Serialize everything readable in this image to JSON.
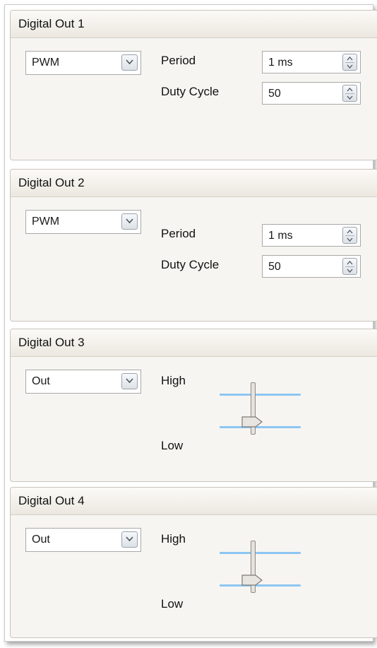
{
  "panels": [
    {
      "title": "Digital Out 1",
      "mode": "PWM",
      "period_label": "Period",
      "period_value": "1 ms",
      "duty_label": "Duty Cycle",
      "duty_value": "50"
    },
    {
      "title": "Digital Out 2",
      "mode": "PWM",
      "period_label": "Period",
      "period_value": "1 ms",
      "duty_label": "Duty Cycle",
      "duty_value": "50"
    },
    {
      "title": "Digital Out 3",
      "mode": "Out",
      "high_label": "High",
      "low_label": "Low",
      "level": "Low"
    },
    {
      "title": "Digital Out 4",
      "mode": "Out",
      "high_label": "High",
      "low_label": "Low",
      "level": "Low"
    }
  ],
  "icons": {
    "dropdown": "chevron-down-icon",
    "spin": "spin-up-down-icon",
    "slider_thumb": "slider-thumb-icon"
  },
  "colors": {
    "panel_bg": "#f7f5f1",
    "slider_track": "#8cc6f3"
  }
}
